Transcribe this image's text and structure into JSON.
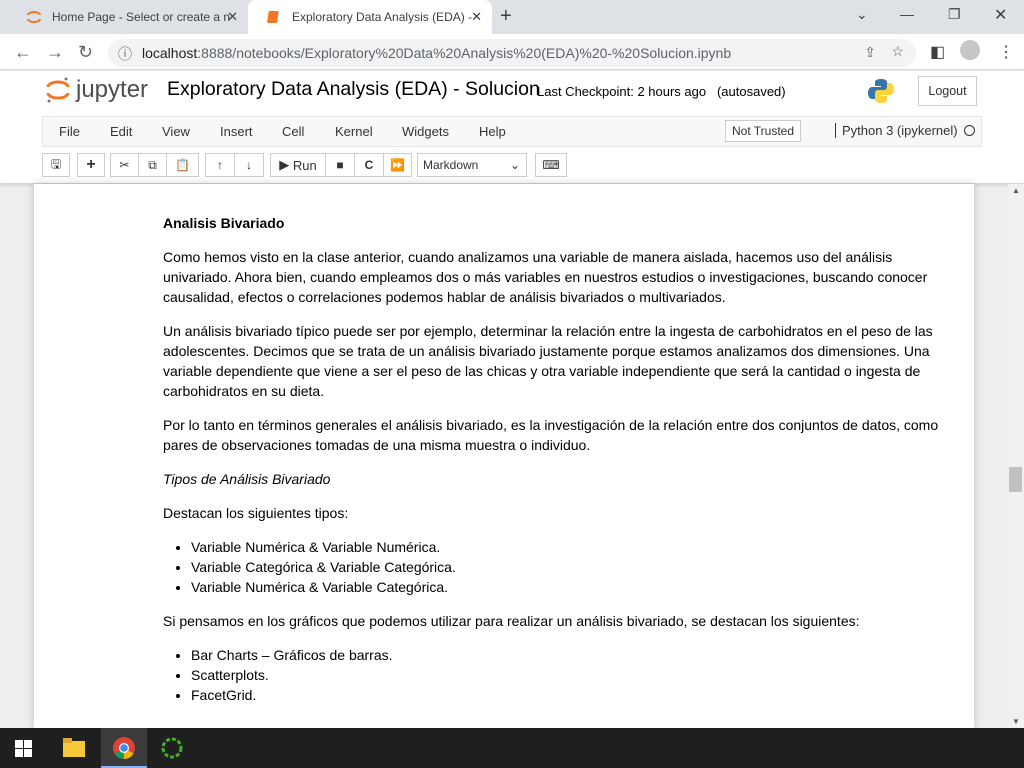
{
  "browser": {
    "tabs": [
      {
        "label": "Home Page - Select or create a n"
      },
      {
        "label": "Exploratory Data Analysis (EDA) -"
      }
    ],
    "url_host": "localhost",
    "url_path": ":8888/notebooks/Exploratory%20Data%20Analysis%20(EDA)%20-%20Solucion.ipynb"
  },
  "jupyter": {
    "logo": "jupyter",
    "title": "Exploratory Data Analysis (EDA) - Solucion",
    "checkpoint": "Last Checkpoint: 2 hours ago",
    "autosaved": "(autosaved)",
    "logout": "Logout",
    "menu": [
      "File",
      "Edit",
      "View",
      "Insert",
      "Cell",
      "Kernel",
      "Widgets",
      "Help"
    ],
    "trusted": "Not Trusted",
    "kernel": "Python 3 (ipykernel)",
    "run": "Run",
    "cell_type": "Markdown"
  },
  "content": {
    "heading": "Analisis Bivariado",
    "p1": "Como hemos visto en la clase anterior, cuando analizamos una variable de manera aislada, hacemos uso del análisis univariado. Ahora bien, cuando empleamos dos o más variables en nuestros estudios o investigaciones, buscando conocer causalidad, efectos o correlaciones podemos hablar de análisis bivariados o multivariados.",
    "p2": "Un análisis bivariado típico puede ser por ejemplo, determinar la relación entre la ingesta de carbohidratos en el peso de las adolescentes. Decimos que se trata de un análisis bivariado justamente porque estamos analizamos dos dimensiones. Una variable dependiente que viene a ser el peso de las chicas y otra variable independiente que será la cantidad o ingesta de carbohidratos en su dieta.",
    "p3": "Por lo tanto en términos generales el análisis bivariado, es la investigación de la relación entre dos conjuntos de datos, como pares de observaciones tomadas de una misma muestra o individuo.",
    "subtitle": "Tipos de Análisis Bivariado",
    "p4": "Destacan los siguientes tipos:",
    "types": [
      "Variable Numérica & Variable Numérica.",
      "Variable Categórica & Variable Categórica.",
      "Variable Numérica & Variable Categórica."
    ],
    "p5": "Si pensamos en los gráficos que podemos utilizar para realizar un análisis bivariado, se destacan los siguientes:",
    "charts": [
      "Bar Charts – Gráficos de barras.",
      "Scatterplots.",
      "FacetGrid."
    ]
  }
}
